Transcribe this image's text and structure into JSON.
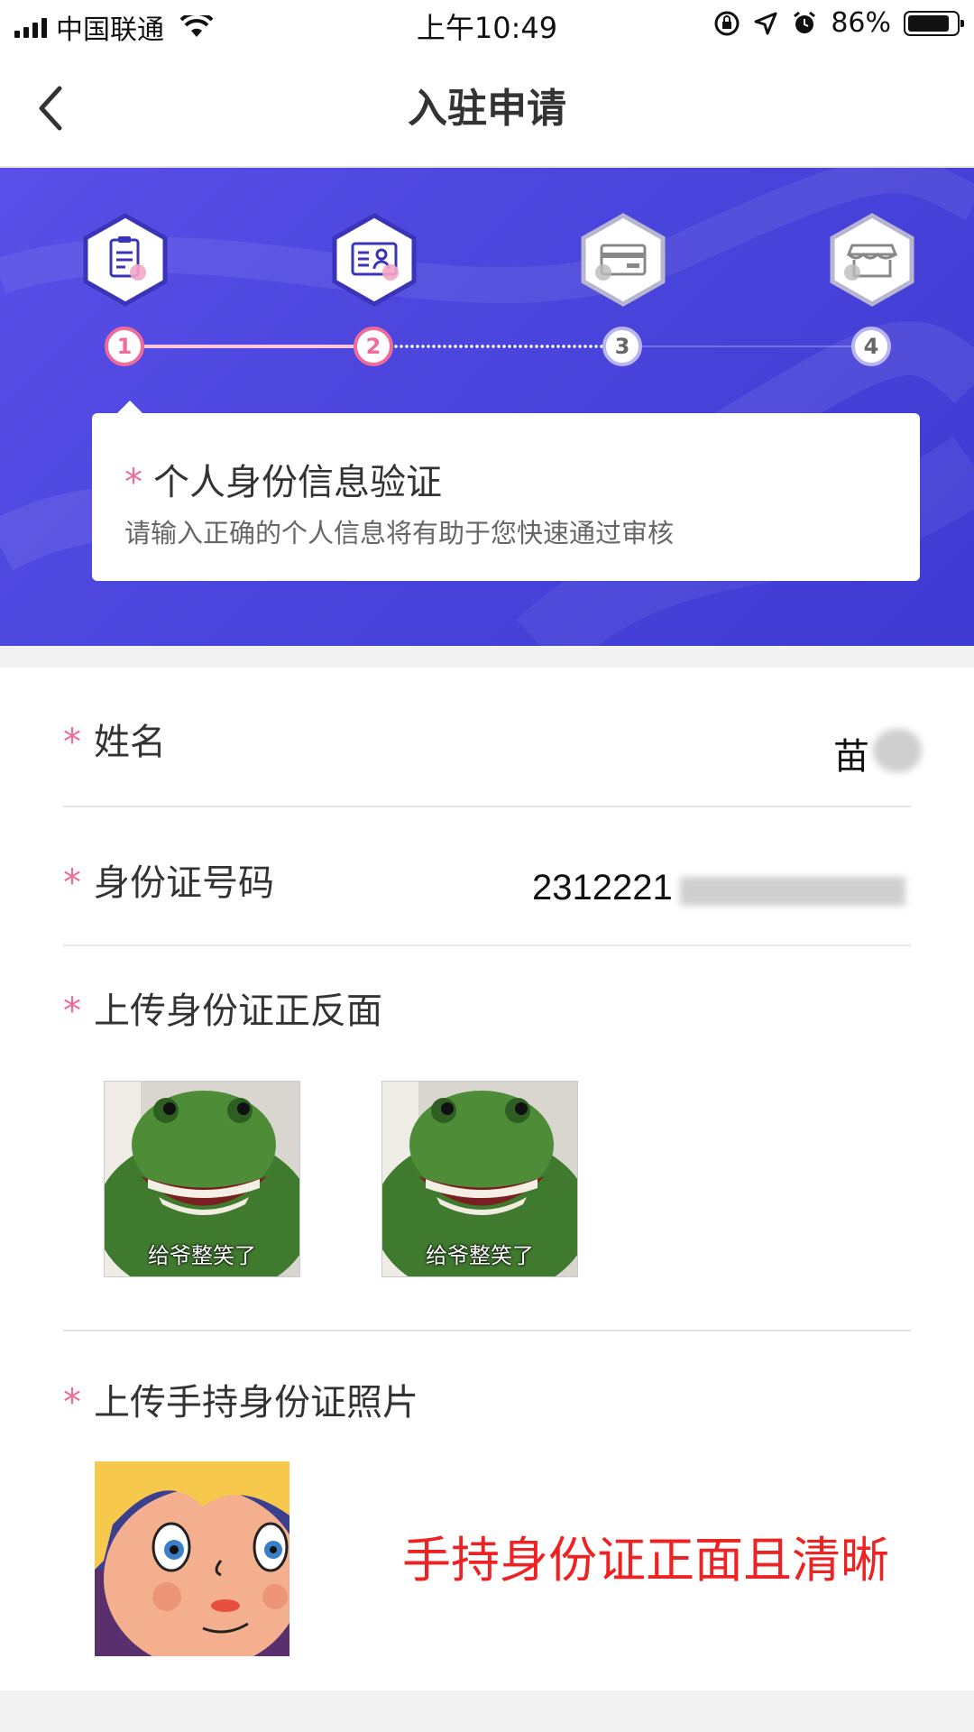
{
  "status_bar": {
    "carrier": "中国联通",
    "time": "上午10:49",
    "battery": "86%",
    "battery_level": 0.86
  },
  "nav": {
    "title": "入驻申请"
  },
  "steps": [
    {
      "number": "1",
      "icon": "clipboard-icon",
      "state": "done"
    },
    {
      "number": "2",
      "icon": "id-card-icon",
      "state": "current"
    },
    {
      "number": "3",
      "icon": "bank-card-icon",
      "state": "pending"
    },
    {
      "number": "4",
      "icon": "store-icon",
      "state": "pending"
    }
  ],
  "info_card": {
    "required_mark": "*",
    "title": "个人身份信息验证",
    "subtitle": "请输入正确的个人信息将有助于您快速通过审核"
  },
  "form": {
    "name": {
      "required_mark": "*",
      "label": "姓名",
      "value": "苗"
    },
    "id_number": {
      "required_mark": "*",
      "label": "身份证号码",
      "value": "2312221"
    },
    "id_photos": {
      "required_mark": "*",
      "label": "上传身份证正反面",
      "images": [
        {
          "caption": "给爷整笑了"
        },
        {
          "caption": "给爷整笑了"
        }
      ]
    },
    "handheld_photo": {
      "required_mark": "*",
      "label": "上传手持身份证照片",
      "note": "手持身份证正面且清晰"
    }
  },
  "colors": {
    "accent_pink": "#f06a9c",
    "hero_blue": "#4a45dc",
    "note_red": "#e22222"
  }
}
